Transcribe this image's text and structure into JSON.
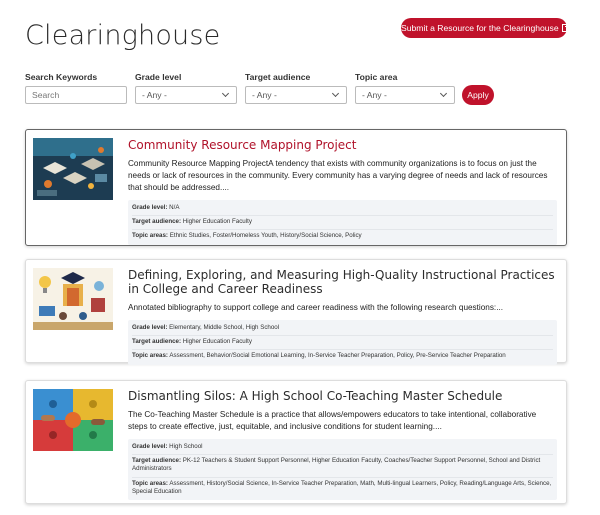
{
  "header": {
    "title": "Clearinghouse",
    "submit_label": "Submit a Resource for the Clearinghouse"
  },
  "filters": {
    "keywords_label": "Search Keywords",
    "keywords_placeholder": "Search",
    "grade_label": "Grade level",
    "grade_value": "- Any -",
    "audience_label": "Target audience",
    "audience_value": "- Any -",
    "topic_label": "Topic area",
    "topic_value": "- Any -",
    "apply_label": "Apply"
  },
  "labels": {
    "grade": "Grade level:",
    "audience": "Target audience:",
    "topics": "Topic areas:"
  },
  "results": [
    {
      "title": "Community Resource Mapping Project",
      "description": "Community Resource Mapping ProjectA tendency that exists with community organizations is to focus on just the needs or lack of resources in the community. Every community has a varying degree of needs and lack of resources that should be addressed....",
      "grade_level": "N/A",
      "target_audience": "Higher Education Faculty",
      "topic_areas": "Ethnic Studies, Foster/Homeless Youth, History/Social Science, Policy"
    },
    {
      "title": "Defining, Exploring, and Measuring High-Quality Instructional Practices in College and Career Readiness",
      "description": "Annotated bibliography to support college and career readiness with the following research questions:...",
      "grade_level": "Elementary, Middle School, High School",
      "target_audience": "Higher Education Faculty",
      "topic_areas": "Assessment, Behavior/Social Emotional Learning, In-Service Teacher Preparation, Policy, Pre-Service Teacher Preparation"
    },
    {
      "title": "Dismantling Silos: A High School Co-Teaching Master Schedule",
      "description": "The Co-Teaching Master Schedule is a practice that allows/empowers educators to take intentional, collaborative steps to create effective, just, equitable, and inclusive conditions for student learning....",
      "grade_level": "High School",
      "target_audience": "PK-12 Teachers & Student Support Personnel, Higher Education Faculty, Coaches/Teacher Support Personnel, School and District Administrators",
      "topic_areas": "Assessment, History/Social Science, In-Service Teacher Preparation, Math, Multi-lingual Learners, Policy, Reading/Language Arts, Science, Special Education"
    }
  ],
  "colors": {
    "accent": "#c0122b",
    "title_link": "#b0122a"
  },
  "icons": [
    "external-link-icon",
    "chevron-down-icon"
  ]
}
